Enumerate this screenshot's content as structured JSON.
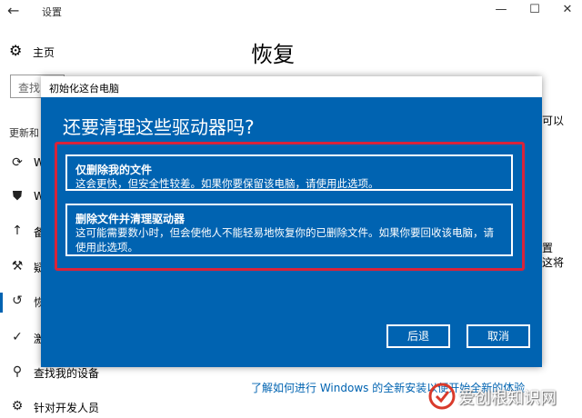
{
  "window": {
    "title": "设置",
    "back_icon": "arrow-left-icon"
  },
  "sidebar": {
    "home_label": "主页",
    "search_placeholder": "查找",
    "section_header": "更新和",
    "items": [
      {
        "icon": "refresh-icon",
        "glyph": "⟳",
        "label": "W"
      },
      {
        "icon": "shield-icon",
        "glyph": "⛊",
        "label": "W"
      },
      {
        "icon": "upload-icon",
        "glyph": "⭱",
        "label": "备"
      },
      {
        "icon": "wrench-icon",
        "glyph": "🔧",
        "label": "疑"
      },
      {
        "icon": "recovery-icon",
        "glyph": "↺",
        "label": "恢"
      },
      {
        "icon": "activation-icon",
        "glyph": "✓",
        "label": "激"
      },
      {
        "icon": "find-device-icon",
        "glyph": "⚲",
        "label": "查找我的设备"
      },
      {
        "icon": "developer-icon",
        "glyph": "⚙",
        "label": "针对开发人员"
      }
    ]
  },
  "main": {
    "title": "恢复",
    "right_fragments": [
      "可以",
      "置",
      "这将"
    ],
    "link": "了解如何进行 Windows 的全新安装以便开始全新的体验"
  },
  "dialog": {
    "title": "初始化这台电脑",
    "question": "还要清理这些驱动器吗?",
    "options": [
      {
        "title": "仅删除我的文件",
        "desc": "这会更快，但安全性较差。如果你要保留该电脑，请使用此选项。"
      },
      {
        "title": "删除文件并清理驱动器",
        "desc": "这可能需要数小时，但会使他人不能轻易地恢复你的已删除文件。如果你要回收该电脑，请使用此选项。"
      }
    ],
    "back_label": "后退",
    "cancel_label": "取消"
  },
  "watermark": {
    "text": "爱创根知识网"
  },
  "colors": {
    "accent": "#0063b1",
    "highlight": "#d8233a"
  }
}
